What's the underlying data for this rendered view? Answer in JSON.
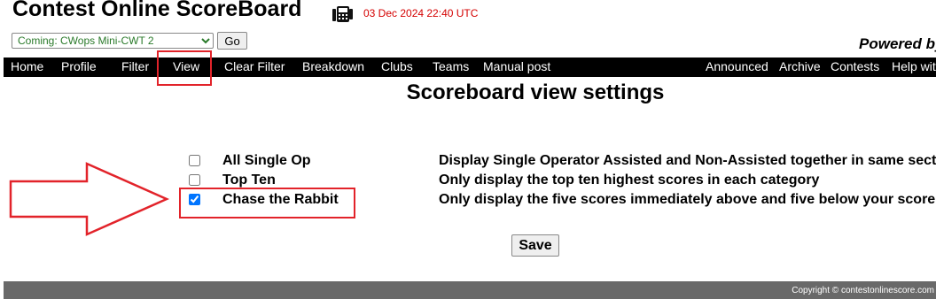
{
  "header": {
    "title": "Contest Online ScoreBoard",
    "timestamp": "03 Dec 2024 22:40 UTC",
    "powered_by": "Powered by"
  },
  "contest_select": {
    "selected": "Coming: CWops Mini-CWT 2"
  },
  "go_label": "Go",
  "nav": {
    "left": [
      "Home",
      "Profile",
      "Filter",
      "View",
      "Clear Filter",
      "Breakdown",
      "Clubs",
      "Teams",
      "Manual post"
    ],
    "right": [
      "Announced",
      "Archive",
      "Contests",
      "Help wit"
    ]
  },
  "main": {
    "heading": "Scoreboard view settings",
    "options": [
      {
        "label": "All Single Op",
        "description": "Display Single Operator Assisted and Non-Assisted together in same sect",
        "checked": false
      },
      {
        "label": "Top Ten",
        "description": "Only display the top ten highest scores in each category",
        "checked": false
      },
      {
        "label": "Chase the Rabbit",
        "description": "Only display the five scores immediately above and five below your score",
        "checked": true
      }
    ],
    "save_label": "Save"
  },
  "footer": {
    "copyright": "Copyright © contestonlinescore.com"
  },
  "colors": {
    "timestamp": "#d40000",
    "annotation": "#e2232a",
    "select_text": "#2a7a2a",
    "navbar_bg": "#000000",
    "footer_bg": "#696969"
  }
}
